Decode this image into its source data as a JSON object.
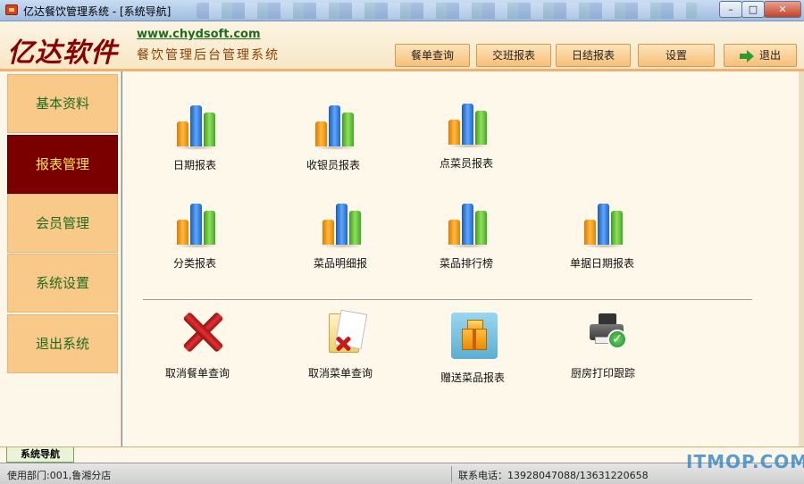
{
  "window": {
    "title": "亿达餐饮管理系统 - [系统导航]",
    "minimize_glyph": "–",
    "maximize_glyph": "□",
    "close_glyph": "✕"
  },
  "header": {
    "brand": "亿达软件",
    "website": "www.chydsoft.com",
    "subtitle": "餐饮管理后台管理系统",
    "buttons": [
      {
        "label": "餐单查询"
      },
      {
        "label": "交班报表"
      },
      {
        "label": "日结报表"
      },
      {
        "label": "设置"
      },
      {
        "label": "退出",
        "icon": "exit-arrow-icon"
      }
    ]
  },
  "sidebar": {
    "items": [
      {
        "label": "基本资料"
      },
      {
        "label": "报表管理",
        "active": true
      },
      {
        "label": "会员管理"
      },
      {
        "label": "系统设置"
      },
      {
        "label": "退出系统"
      }
    ]
  },
  "reports": [
    {
      "label": "日期报表",
      "icon": "bar-chart-icon"
    },
    {
      "label": "收银员报表",
      "icon": "bar-chart-icon"
    },
    {
      "label": "点菜员报表",
      "icon": "bar-chart-icon"
    },
    {
      "label": "分类报表",
      "icon": "bar-chart-icon"
    },
    {
      "label": "菜品明细报",
      "icon": "bar-chart-icon"
    },
    {
      "label": "菜品排行榜",
      "icon": "bar-chart-icon"
    },
    {
      "label": "单据日期报表",
      "icon": "bar-chart-icon"
    }
  ],
  "actions": [
    {
      "label": "取消餐单查询",
      "icon": "red-x-icon"
    },
    {
      "label": "取消菜单查询",
      "icon": "folder-x-icon"
    },
    {
      "label": "赠送菜品报表",
      "icon": "gift-box-icon"
    },
    {
      "label": "厨房打印跟踪",
      "icon": "printer-check-icon"
    }
  ],
  "bottom_tab": {
    "label": "系统导航"
  },
  "status": {
    "department": "使用部门:001,鲁湘分店",
    "phone": "联系电话：13928047088/13631220658"
  },
  "watermark": "ITMOP.COM",
  "colors": {
    "accent_dark_red": "#7a0000",
    "sidebar_orange": "#f9c98a",
    "active_text": "#ffe55c",
    "label_green": "#1f6b1f"
  }
}
